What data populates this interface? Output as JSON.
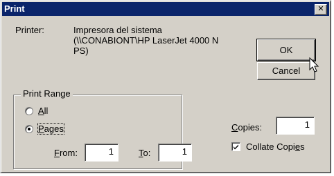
{
  "window": {
    "title": "Print",
    "close_glyph": "✕"
  },
  "printer": {
    "label": "Printer:",
    "name": "Impresora del sistema\n(\\\\CONABIONT\\HP LaserJet 4000 N\nPS)"
  },
  "buttons": {
    "ok": "OK",
    "cancel": "Cancel"
  },
  "print_range": {
    "title": "Print Range",
    "all": {
      "letter": "A",
      "rest": "ll",
      "selected": false
    },
    "pages": {
      "letter": "P",
      "rest": "ages",
      "selected": true
    },
    "from": {
      "letter": "F",
      "rest": "rom:",
      "value": "1"
    },
    "to": {
      "letter": "T",
      "rest": "o:",
      "value": "1"
    }
  },
  "copies": {
    "letter": "C",
    "rest": "opies:",
    "value": "1"
  },
  "collate": {
    "prefix": "Collate Copi",
    "letter": "e",
    "suffix": "s",
    "checked": true
  },
  "icons": {
    "cursor": "arrow-cursor-icon",
    "check": "checkmark-icon"
  }
}
